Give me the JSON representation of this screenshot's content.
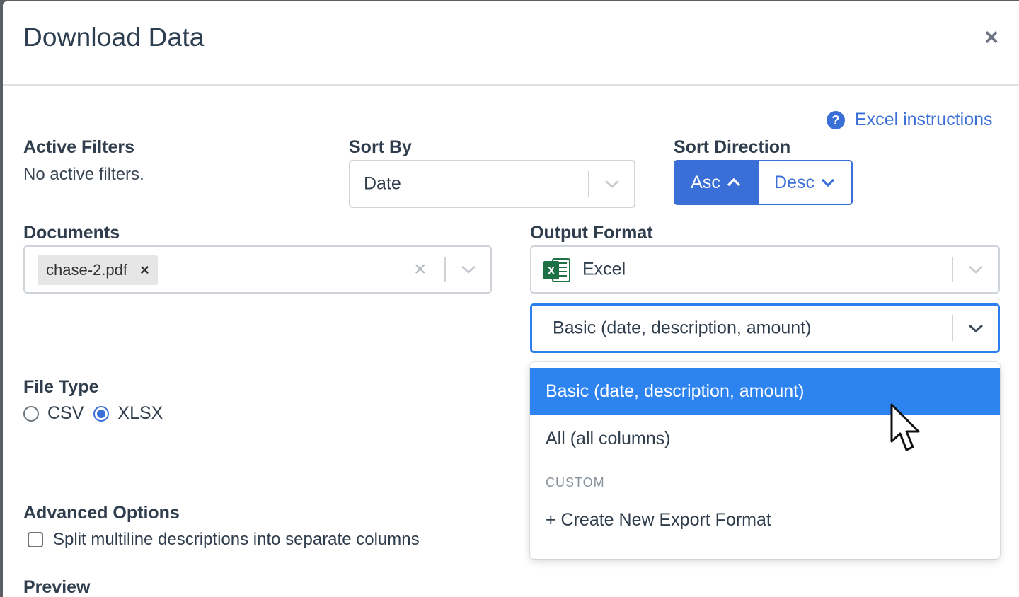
{
  "modal": {
    "title": "Download Data"
  },
  "help": {
    "label": "Excel instructions",
    "icon": "question-circle-icon"
  },
  "active_filters": {
    "label": "Active Filters",
    "value": "No active filters."
  },
  "sort_by": {
    "label": "Sort By",
    "value": "Date"
  },
  "sort_direction": {
    "label": "Sort Direction",
    "asc": "Asc",
    "desc": "Desc",
    "selected": "Asc"
  },
  "documents": {
    "label": "Documents",
    "tags": [
      "chase-2.pdf"
    ]
  },
  "output_format": {
    "label": "Output Format",
    "value": "Excel",
    "columns_value": "Basic (date, description, amount)",
    "options": [
      "Basic (date, description, amount)",
      "All (all columns)"
    ],
    "custom_heading": "CUSTOM",
    "create_label": "+ Create New Export Format",
    "selected_index": 0
  },
  "file_type": {
    "label": "File Type",
    "options": [
      "CSV",
      "XLSX"
    ],
    "selected": "XLSX"
  },
  "advanced": {
    "label": "Advanced Options",
    "checkbox_label": "Split multiline descriptions into separate columns",
    "checked": false
  },
  "preview": {
    "label": "Preview"
  },
  "colors": {
    "accent": "#3a6fd8",
    "option_selected": "#2d84f0",
    "excel_green": "#1e7145"
  }
}
